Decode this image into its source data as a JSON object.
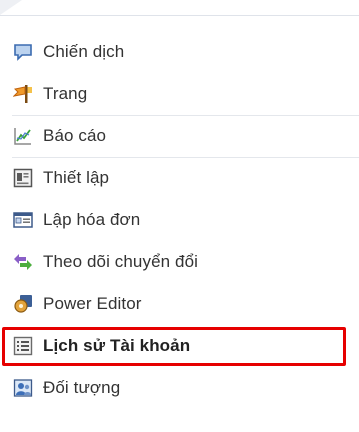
{
  "menu": {
    "items": [
      {
        "label": "Chiến dịch",
        "icon": "campaign-speech-bubble-icon"
      },
      {
        "label": "Trang",
        "icon": "pages-flag-icon"
      },
      {
        "label": "Báo cáo",
        "icon": "reports-chart-icon"
      },
      {
        "label": "Thiết lập",
        "icon": "settings-window-icon"
      },
      {
        "label": "Lập hóa đơn",
        "icon": "billing-card-icon"
      },
      {
        "label": "Theo dõi chuyển đổi",
        "icon": "conversion-tracking-arrows-icon"
      },
      {
        "label": "Power Editor",
        "icon": "power-editor-gear-icon"
      },
      {
        "label": "Lịch sử Tài khoản",
        "icon": "account-history-list-icon",
        "selected": true
      },
      {
        "label": "Đối tượng",
        "icon": "audiences-people-icon"
      }
    ]
  },
  "colors": {
    "highlight_border": "#e60000",
    "text": "#333333"
  }
}
